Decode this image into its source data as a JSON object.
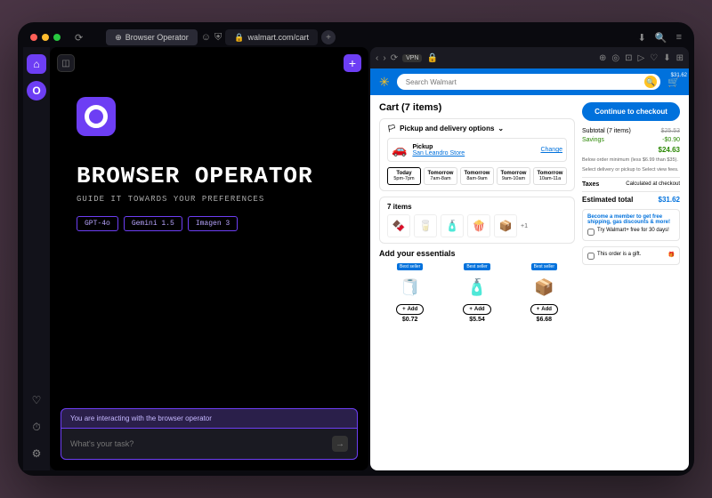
{
  "tabs": {
    "operator": "Browser Operator",
    "site": "walmart.com/cart"
  },
  "operator": {
    "title": "BROWSER OPERATOR",
    "subtitle": "GUIDE IT TOWARDS YOUR PREFERENCES",
    "chips": [
      "GPT-4o",
      "Gemini 1.5",
      "Imagen 3"
    ],
    "notice": "You are interacting with the browser operator",
    "placeholder": "What's your task?"
  },
  "walmart": {
    "searchPlaceholder": "Search Walmart",
    "cartAmount": "$31.62",
    "cartTitle": "Cart (7 items)",
    "deliveryHead": "Pickup and delivery options",
    "pickup": {
      "label": "Pickup",
      "store": "San Leandro Store",
      "change": "Change"
    },
    "slots": [
      {
        "day": "Today",
        "time": "5pm-7pm"
      },
      {
        "day": "Tomorrow",
        "time": "7am-8am"
      },
      {
        "day": "Tomorrow",
        "time": "8am-9am"
      },
      {
        "day": "Tomorrow",
        "time": "9am-10am"
      },
      {
        "day": "Tomorrow",
        "time": "10am-11a"
      }
    ],
    "itemsLabel": "7 items",
    "plusOne": "+1",
    "essentialsTitle": "Add your essentials",
    "essentials": [
      {
        "badge": "Best seller",
        "price": "$0.72"
      },
      {
        "badge": "Best seller",
        "price": "$5.54"
      },
      {
        "badge": "Best seller",
        "price": "$6.68"
      }
    ],
    "addLabel": "Add",
    "checkout": "Continue to checkout",
    "summary": {
      "subtotalLabel": "Subtotal (7 items)",
      "subtotalOld": "$25.53",
      "savingsLabel": "Savings",
      "savings": "-$0.90",
      "afterSavings": "$24.63",
      "minNote": "Below order minimum (less $6.99 than $35).",
      "selectNote": "Select delivery or pickup to Select view fees.",
      "taxesLabel": "Taxes",
      "taxes": "Calculated at checkout",
      "estLabel": "Estimated total",
      "est": "$31.62"
    },
    "promo": {
      "title": "Become a member to get free shipping, gas discounts & more!",
      "trial": "Try Walmart+ free for 30 days!"
    },
    "gift": "This order is a gift."
  }
}
